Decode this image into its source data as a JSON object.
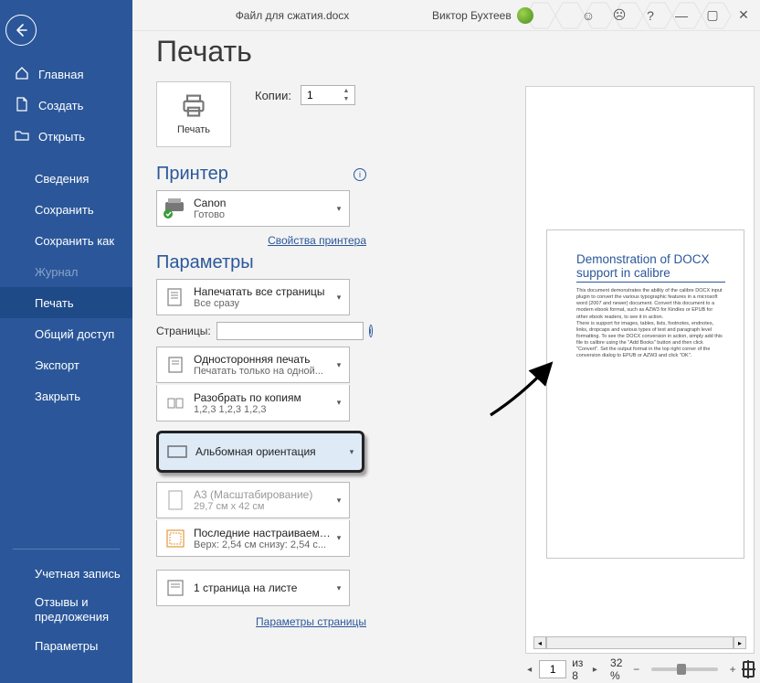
{
  "titlebar": {
    "document_name": "Файл для сжатия.docx",
    "user_name": "Виктор Бухтеев"
  },
  "sidebar": {
    "home": "Главная",
    "create": "Создать",
    "open": "Открыть",
    "info": "Сведения",
    "save": "Сохранить",
    "saveas": "Сохранить как",
    "history": "Журнал",
    "print": "Печать",
    "share": "Общий доступ",
    "export": "Экспорт",
    "close": "Закрыть",
    "account": "Учетная запись",
    "feedback": "Отзывы и предложения",
    "options": "Параметры"
  },
  "print": {
    "title": "Печать",
    "button_label": "Печать",
    "copies_label": "Копии:",
    "copies_value": "1",
    "printer_heading": "Принтер",
    "printer_name": "Canon",
    "printer_status": "Готово",
    "printer_props_link": "Свойства принтера",
    "settings_heading": "Параметры",
    "all_pages_l1": "Напечатать все страницы",
    "all_pages_l2": "Все сразу",
    "pages_label": "Страницы:",
    "pages_value": "",
    "side_l1": "Односторонняя печать",
    "side_l2": "Печатать только на одной...",
    "collate_l1": "Разобрать по копиям",
    "collate_l2": "1,2,3   1,2,3   1,2,3",
    "orientation_l1": "Альбомная ориентация",
    "paper_l1": "A3 (Масштабирование)",
    "paper_l2": "29,7 см x 42 см",
    "margins_l1": "Последние настраиваемы...",
    "margins_l2": "Верх: 2,54 см снизу: 2,54 с...",
    "perpage_l1": "1 страница на листе",
    "page_setup_link": "Параметры страницы"
  },
  "preview": {
    "doc_title": "Demonstration of DOCX support in calibre",
    "doc_p1": "This document demonstrates the ability of the calibre DOCX input plugin to convert the various typographic features in a microsoft word (2007 and newer) document. Convert this document to a modern ebook format, such as AZW3 for Kindles or EPUB for other ebook readers, to see it in action.",
    "doc_p2": "There is support for images, tables, lists, footnotes, endnotes, links, dropcaps and various types of text and paragraph level formatting. To see the DOCX conversion in action, simply add this file to calibre using the \"Add Books\" button and then click \"Convert\". Set the output format in the top right corner of the conversion dialog to EPUB or AZW3 and click \"OK\"."
  },
  "footer": {
    "current_page": "1",
    "of_label": "из 8",
    "zoom_label": "32 %"
  }
}
